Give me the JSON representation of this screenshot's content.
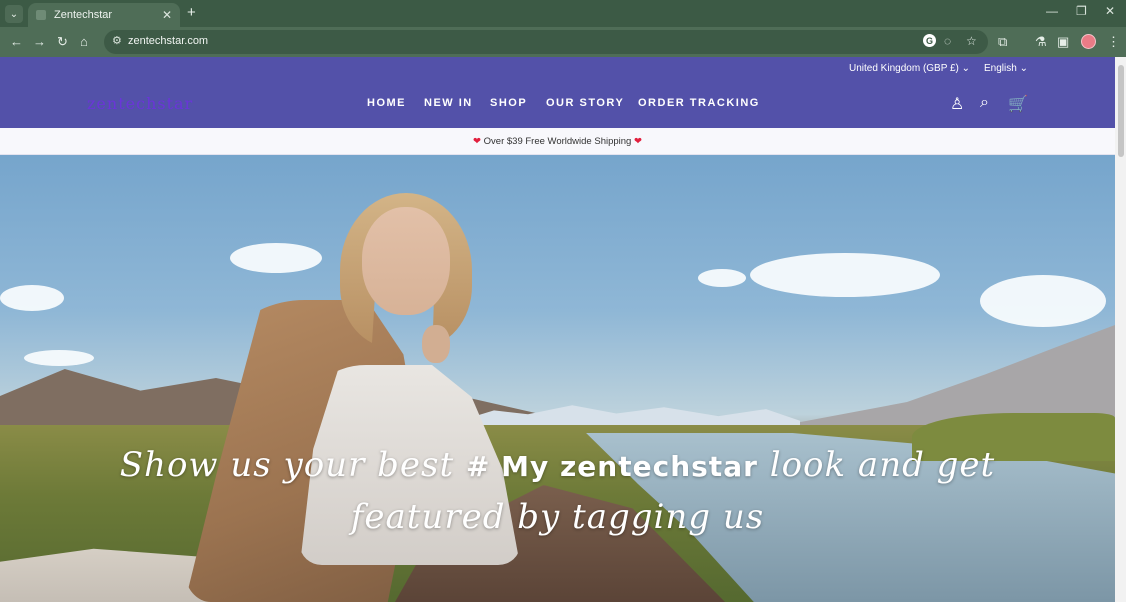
{
  "browser": {
    "tab_title": "Zentechstar",
    "url": "zentechstar.com",
    "icons": [
      "tab-search-icon",
      "close-icon",
      "plus-icon",
      "minimize-icon",
      "restore-icon",
      "close-window-icon",
      "back-icon",
      "forward-icon",
      "reload-icon",
      "home-icon",
      "site-info-icon",
      "google-icon",
      "eye-off-icon",
      "star-icon",
      "extensions-icon",
      "labs-icon",
      "side-panel-icon",
      "avatar-icon",
      "more-icon"
    ]
  },
  "site": {
    "locale": {
      "country": "United Kingdom",
      "currency": "(GBP £)",
      "language": "English"
    },
    "logo_text": "zentechstar",
    "nav": [
      "HOME",
      "NEW IN",
      "SHOP",
      "OUR STORY",
      "ORDER TRACKING"
    ],
    "header_icons": [
      "account-icon",
      "search-icon",
      "cart-icon"
    ],
    "announcement": "Over $39 Free Worldwide Shipping",
    "hero": {
      "line1_start": "Show us your best",
      "hashtag": "# My zentechstar",
      "line1_end": "look and get",
      "line2": "featured by tagging us"
    }
  },
  "colors": {
    "chrome": "#4f6d57",
    "header": "#5351a9",
    "heart": "#e21f3d"
  }
}
